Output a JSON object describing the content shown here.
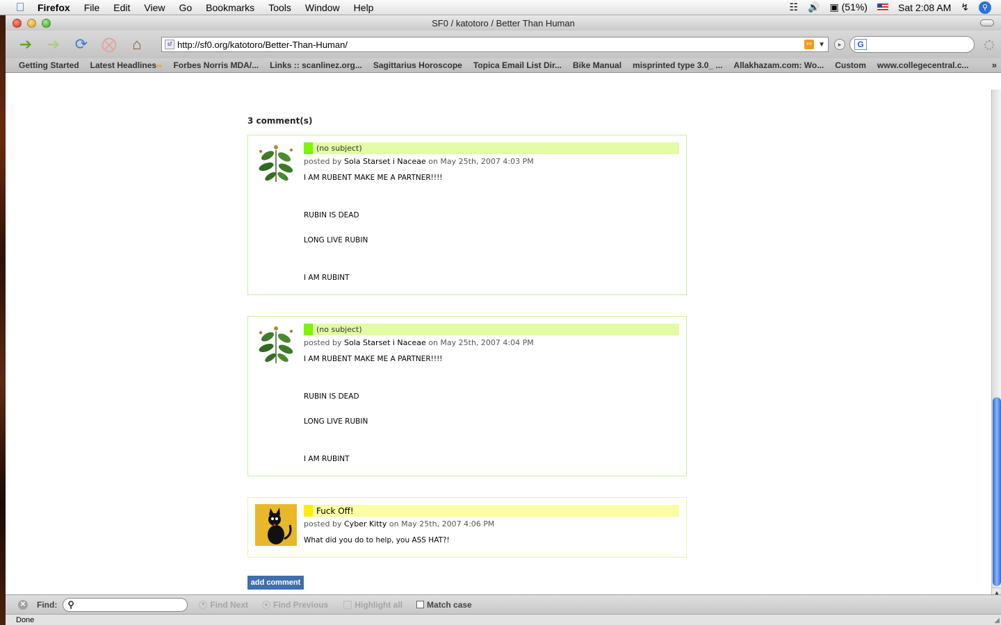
{
  "menubar": {
    "app": "Firefox",
    "items": [
      "File",
      "Edit",
      "View",
      "Go",
      "Bookmarks",
      "Tools",
      "Window",
      "Help"
    ],
    "battery": "(51%)",
    "clock": "Sat 2:08 AM"
  },
  "window": {
    "title": "SF0 / katotoro / Better Than Human"
  },
  "navbar": {
    "url": "http://sf0.org/katotoro/Better-Than-Human/",
    "search_placeholder": ""
  },
  "bookmarks": [
    "Getting Started",
    "Latest Headlines",
    "Forbes Norris MDA/...",
    "Links :: scanlinez.org...",
    "Sagittarius Horoscope",
    "Topica Email List Dir...",
    "Bike Manual",
    "misprinted type 3.0_ ...",
    "Allakhazam.com: Wo...",
    "Custom",
    "www.collegecentral.c..."
  ],
  "page": {
    "comments_count": "3 comment(s)",
    "comments": [
      {
        "subject": "(no subject)",
        "posted_prefix": "posted by",
        "author": "Sola Starset i Naceae",
        "date": "on May 25th, 2007 4:03 PM",
        "lines": [
          "I AM RUBENT MAKE ME A PARTNER!!!!",
          "",
          "",
          "RUBIN IS DEAD",
          "",
          "LONG LIVE RUBIN",
          "",
          "",
          "I AM RUBINT"
        ]
      },
      {
        "subject": "(no subject)",
        "posted_prefix": "posted by",
        "author": "Sola Starset i Naceae",
        "date": "on May 25th, 2007 4:04 PM",
        "lines": [
          "I AM RUBENT MAKE ME A PARTNER!!!!",
          "",
          "",
          "RUBIN IS DEAD",
          "",
          "LONG LIVE RUBIN",
          "",
          "",
          "I AM RUBINT"
        ]
      },
      {
        "subject": "Fuck Off!",
        "posted_prefix": "posted by",
        "author": "Cyber Kitty",
        "date": "on May 25th, 2007 4:06 PM",
        "lines": [
          "What did you do to help, you ASS HAT?!"
        ]
      }
    ],
    "add_comment": "add comment"
  },
  "findbar": {
    "label": "Find:",
    "find_next": "Find Next",
    "find_previous": "Find Previous",
    "highlight_all": "Highlight all",
    "match_case": "Match case"
  },
  "status": "Done",
  "colors": {
    "accent_green": "#7cf500",
    "accent_yellow": "#ffee00",
    "button_blue": "#3f6fad"
  }
}
